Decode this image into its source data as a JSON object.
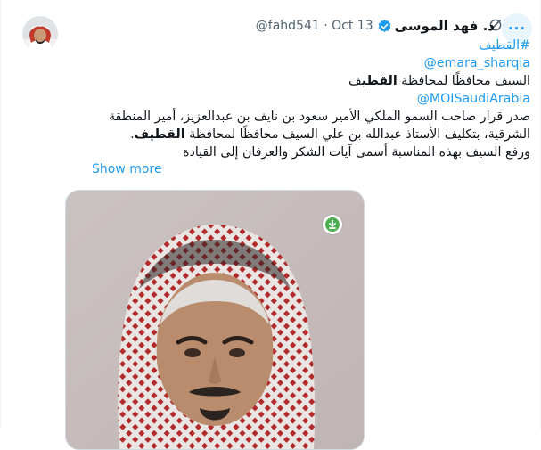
{
  "tweet": {
    "display_name": "د. فهد الموسى",
    "handle": "@fahd541",
    "separator": "·",
    "date": "Oct 13",
    "show_more": "Show more",
    "lines": {
      "hashtag": "#القطيف",
      "mention_1": "@emara_sharqia",
      "line_3_pre": "السيف محافظًا لمحافظة ",
      "line_3_bold": "القطي",
      "line_3_post": "ف",
      "mention_2": "@MOISaudiArabia",
      "line_5": "صدر قرار صاحب السمو الملكي الأمير سعود بن نايف بن عبدالعزيز، أمير المنطقة",
      "line_6_pre": "الشرقية، بتكليف الأستاذ عبدالله بن علي السيف محافظًا لمحافظة ",
      "line_6_bold": "القطيف",
      "line_6_post": ".",
      "line_7": "ورفع السيف بهذه المناسبة أسمى آيات الشكر والعرفان إلى القيادة"
    }
  },
  "icons": {
    "more": "more-horizontal-icon",
    "grok": "grok-icon",
    "verified": "verified-badge-icon",
    "download": "download-icon"
  },
  "colors": {
    "accent": "#1d9bf0",
    "text": "#0f1419",
    "muted": "#536471",
    "verified": "#1d9bf0",
    "download_badge": "#4caf50"
  }
}
